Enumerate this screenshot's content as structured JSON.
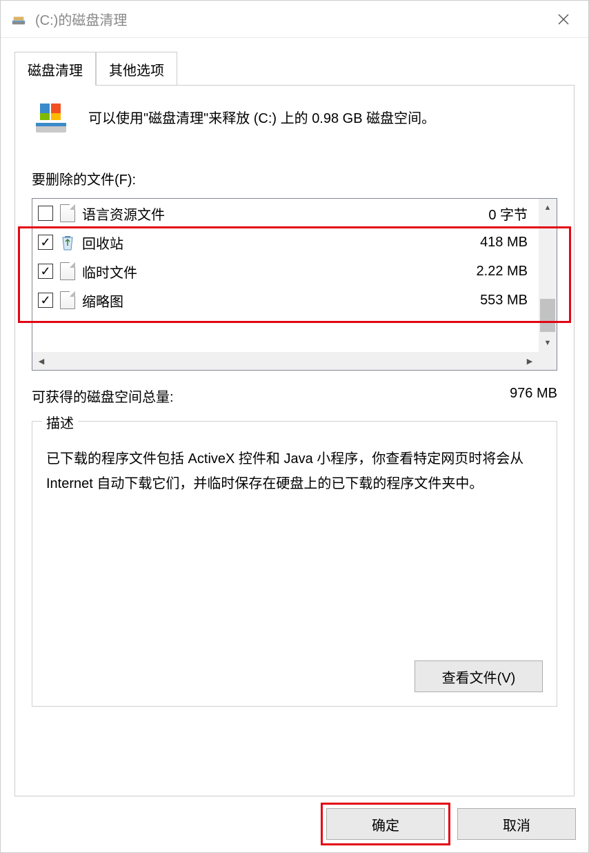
{
  "window": {
    "title": "(C:)的磁盘清理"
  },
  "tabs": {
    "cleanup": "磁盘清理",
    "other": "其他选项"
  },
  "intro": "可以使用\"磁盘清理\"来释放  (C:) 上的 0.98 GB 磁盘空间。",
  "files_label": "要删除的文件(F):",
  "files": [
    {
      "name": "语言资源文件",
      "size": "0 字节",
      "checked": false,
      "icon": "file"
    },
    {
      "name": "回收站",
      "size": "418 MB",
      "checked": true,
      "icon": "recycle"
    },
    {
      "name": "临时文件",
      "size": "2.22 MB",
      "checked": true,
      "icon": "file"
    },
    {
      "name": "缩略图",
      "size": "553 MB",
      "checked": true,
      "icon": "file"
    }
  ],
  "total": {
    "label": "可获得的磁盘空间总量:",
    "value": "976 MB"
  },
  "description": {
    "label": "描述",
    "text": "已下载的程序文件包括 ActiveX 控件和 Java 小程序，你查看特定网页时将会从 Internet 自动下载它们，并临时保存在硬盘上的已下载的程序文件夹中。"
  },
  "buttons": {
    "view_files": "查看文件(V)",
    "ok": "确定",
    "cancel": "取消"
  }
}
